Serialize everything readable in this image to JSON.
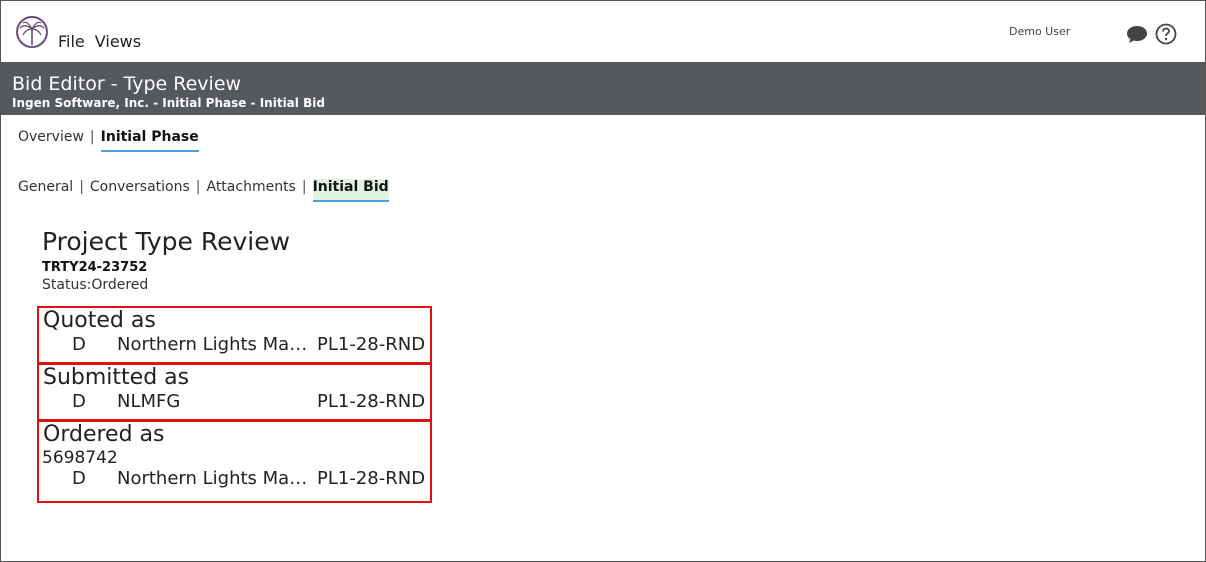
{
  "topbar": {
    "menu": [
      "File",
      "Views"
    ],
    "user": "Demo User"
  },
  "header": {
    "title": "Bid Editor - Type Review",
    "subtitle": "Ingen Software, Inc. - Initial Phase - Initial Bid"
  },
  "tabs_primary": [
    {
      "label": "Overview",
      "active": false
    },
    {
      "label": "Initial Phase",
      "active": true
    }
  ],
  "tabs_secondary": [
    {
      "label": "General",
      "active": false
    },
    {
      "label": "Conversations",
      "active": false
    },
    {
      "label": "Attachments",
      "active": false
    },
    {
      "label": "Initial Bid",
      "active": true
    }
  ],
  "project": {
    "title": "Project Type Review",
    "id": "TRTY24-23752",
    "status": "Status:Ordered"
  },
  "sections": {
    "quoted": {
      "heading": "Quoted as",
      "row": {
        "code": "D",
        "name": "Northern Lights Manufacturing",
        "part": "PL1-28-RND"
      }
    },
    "submitted": {
      "heading": "Submitted as",
      "row": {
        "code": "D",
        "name": "NLMFG",
        "part": "PL1-28-RND"
      }
    },
    "ordered": {
      "heading": "Ordered as",
      "number": "5698742",
      "row": {
        "code": "D",
        "name": "Northern Lights Manufacturing",
        "part": "PL1-28-RND"
      }
    }
  },
  "colors": {
    "header_bg": "#55585c",
    "accent": "#4ba3d9",
    "highlight_box": "#e01010",
    "active_tab_bg": "#dff2e3"
  },
  "icons": [
    "palm-tree-logo-icon",
    "chat-bubble-icon",
    "help-icon"
  ]
}
